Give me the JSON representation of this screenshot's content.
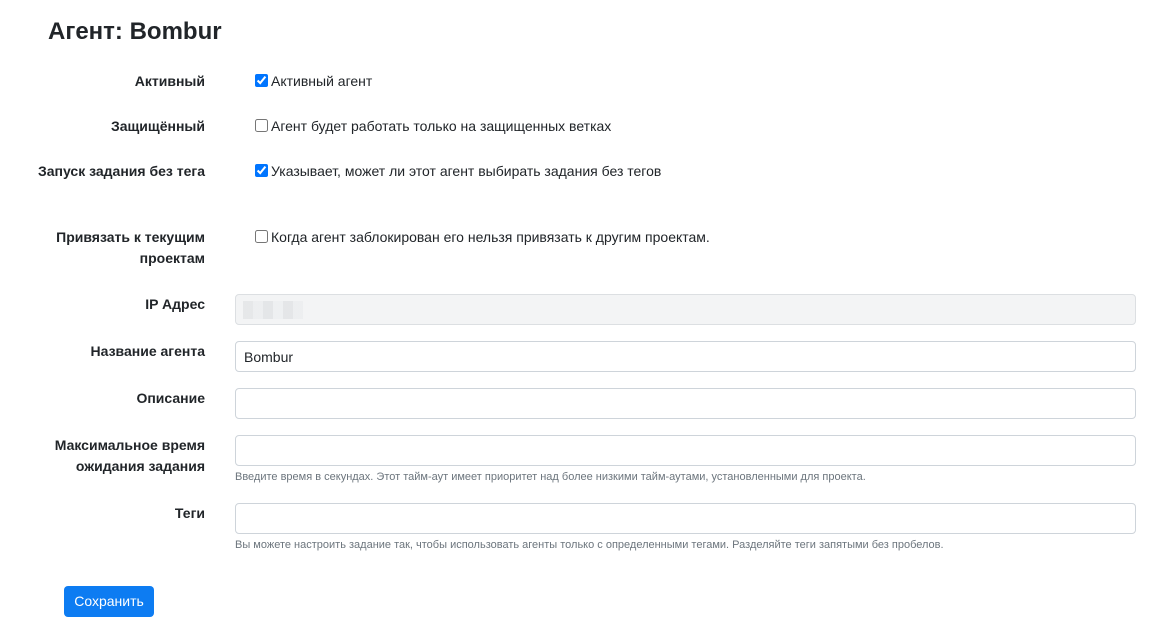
{
  "page": {
    "title": "Агент: Bombur"
  },
  "form": {
    "active": {
      "label": "Активный",
      "checkbox_text": "Активный агент",
      "checked": true
    },
    "protected": {
      "label": "Защищённый",
      "checkbox_text": "Агент будет работать только на защищенных ветках",
      "checked": false
    },
    "run_untagged": {
      "label": "Запуск задания без тега",
      "checkbox_text": "Указывает, может ли этот агент выбирать задания без тегов",
      "checked": true
    },
    "locked": {
      "label": "Привязать к текущим проектам",
      "checkbox_text": "Когда агент заблокирован его нельзя привязать к другим проектам.",
      "checked": false
    },
    "ip_address": {
      "label": "IP Адрес",
      "value": ""
    },
    "agent_name": {
      "label": "Название агента",
      "value": "Bombur"
    },
    "description": {
      "label": "Описание",
      "value": ""
    },
    "max_timeout": {
      "label": "Максимальное время ожидания задания",
      "value": "",
      "help": "Введите время в секундах. Этот тайм-аут имеет приоритет над более низкими тайм-аутами, установленными для проекта."
    },
    "tags": {
      "label": "Теги",
      "value": "",
      "help": "Вы можете настроить задание так, чтобы использовать агенты только с определенными тегами. Разделяйте теги запятыми без пробелов."
    },
    "save_label": "Сохранить"
  },
  "colors": {
    "primary_button": "#0d7cf2",
    "input_border": "#ced4da",
    "readonly_bg": "#f3f4f5",
    "help_text": "#6c757d"
  }
}
